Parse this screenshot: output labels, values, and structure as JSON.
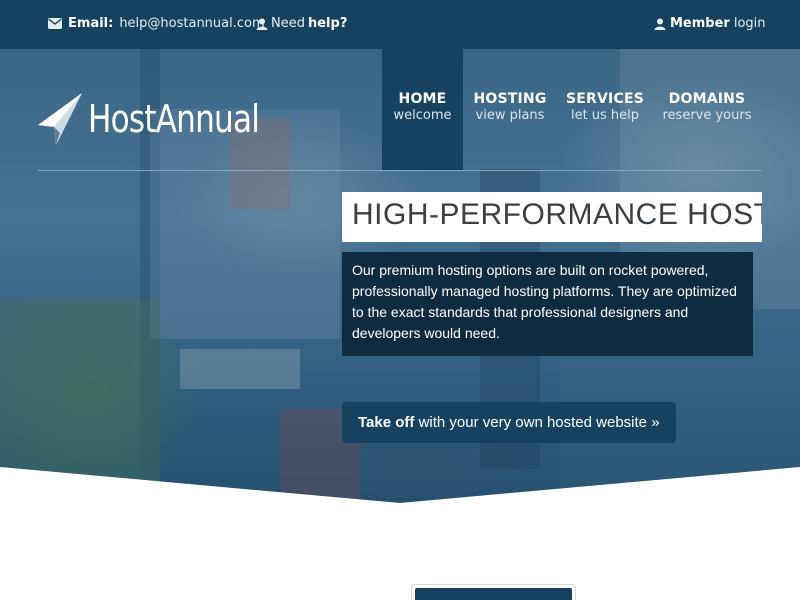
{
  "topbar": {
    "email_label": "Email:",
    "email_value": "help@hostannual.com",
    "help_prefix": "Need",
    "help_bold": "help?",
    "member_bold": "Member",
    "member_rest": "login",
    "icons": [
      "envelope-icon",
      "user-icon",
      "user-icon"
    ]
  },
  "logo": {
    "name": "HostAnnual"
  },
  "nav": [
    {
      "title": "HOME",
      "subtitle": "welcome",
      "active": true
    },
    {
      "title": "HOSTING",
      "subtitle": "view plans",
      "active": false
    },
    {
      "title": "SERVICES",
      "subtitle": "let us help",
      "active": false
    },
    {
      "title": "DOMAINS",
      "subtitle": "reserve yours",
      "active": false
    }
  ],
  "hero": {
    "headline": "HIGH-PERFORMANCE HOSTING",
    "description": "Our premium hosting options are built on rocket powered, professionally managed hosting platforms. They are optimized to the exact standards that professional designers and developers would need.",
    "cta_bold": "Take off",
    "cta_rest": "with your very own hosted website »"
  },
  "colors": {
    "brand_dark": "#17425f",
    "panel_dark": "#0f2b40",
    "white": "#ffffff"
  }
}
